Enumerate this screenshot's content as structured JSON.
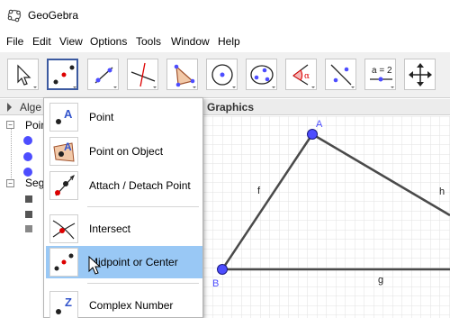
{
  "window": {
    "title": "GeoGebra"
  },
  "menu": [
    "File",
    "Edit",
    "View",
    "Options",
    "Tools",
    "Window",
    "Help"
  ],
  "toolbar": {
    "tools": [
      "move",
      "point",
      "line",
      "perpendicular-line",
      "polygon",
      "circle",
      "conic",
      "angle",
      "reflect",
      "slider",
      "move-view"
    ],
    "slider_label": "a = 2"
  },
  "algebra": {
    "header": "Alge",
    "groups": [
      {
        "label": "Poin",
        "items": 3
      },
      {
        "label": "Seg",
        "items": 3
      }
    ]
  },
  "graphics": {
    "header": "Graphics",
    "points": [
      {
        "label": "A",
        "color": "#4d4dff"
      },
      {
        "label": "B",
        "color": "#4d4dff"
      }
    ],
    "segments": [
      "f",
      "g",
      "h"
    ]
  },
  "dropdown": {
    "items": [
      {
        "label": "Point",
        "icon": "point-icon"
      },
      {
        "label": "Point on Object",
        "icon": "point-on-object-icon"
      },
      {
        "label": "Attach / Detach Point",
        "icon": "attach-detach-icon"
      },
      {
        "label": "Intersect",
        "icon": "intersect-icon"
      },
      {
        "label": "Midpoint or Center",
        "icon": "midpoint-icon",
        "hover": true
      },
      {
        "label": "Complex Number",
        "icon": "complex-number-icon"
      }
    ]
  },
  "colors": {
    "accent": "#3c5aa0",
    "hover": "#99c8f5",
    "point": "#4d4dff"
  }
}
